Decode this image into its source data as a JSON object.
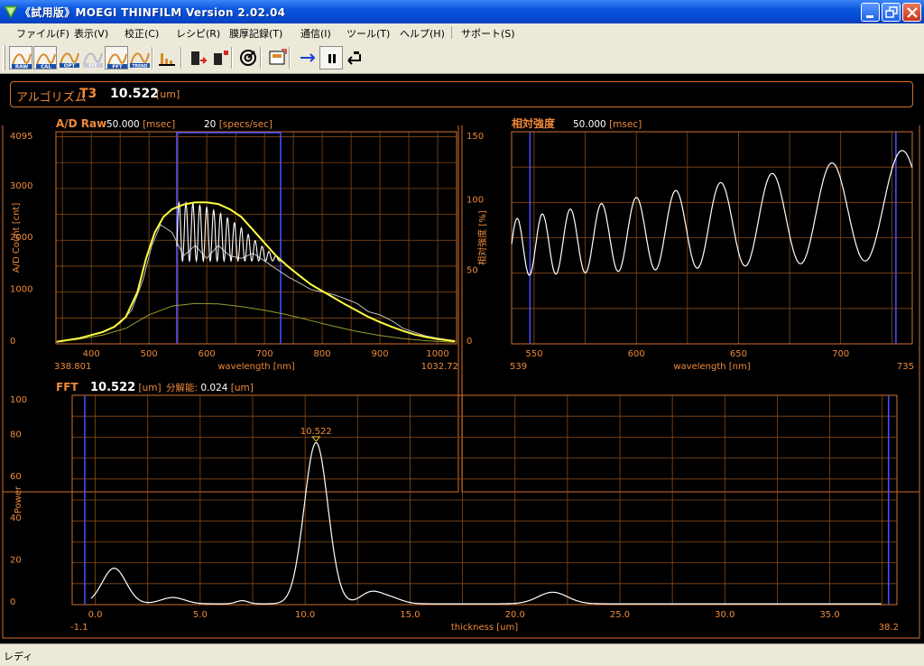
{
  "window": {
    "title": "《試用版》MOEGI THINFILM Version 2.02.04"
  },
  "menu": [
    "ファイル(F)",
    "表示(V)",
    "校正(C)",
    "レシピ(R)",
    "膜厚記録(T)",
    "通信(I)",
    "ツール(T)",
    "ヘルプ(H)",
    "サポート(S)"
  ],
  "toolbar": {
    "icons": [
      {
        "name": "raw-mode-icon",
        "label": "RAW",
        "pressed": true
      },
      {
        "name": "cal-mode-icon",
        "label": "CAL",
        "pressed": true
      },
      {
        "name": "opt-mode-icon",
        "label": "OPT",
        "pressed": false
      },
      {
        "name": "fit-mode-icon",
        "label": "FIT",
        "pressed": false
      },
      {
        "name": "fft-mode-icon",
        "label": "FFT",
        "pressed": true
      },
      {
        "name": "trend-mode-icon",
        "label": "TREND",
        "pressed": false
      }
    ]
  },
  "result": {
    "algorithm_label": "アルゴリズム",
    "algorithm": "T3",
    "value": "10.522",
    "unit": "[um]"
  },
  "status": {
    "text": "レディ"
  },
  "colors": {
    "accent": "#d2702c",
    "grid": "#8a4a16",
    "series_raw": "#ffff40",
    "series_gray": "#bdbdbd",
    "series_dark": "#9a9a30",
    "cursor": "#4e50ff",
    "trace": "#ffffff"
  },
  "chart_data": [
    {
      "name": "ad-raw-chart",
      "type": "line",
      "title": "A/D Raw",
      "header_items": [
        {
          "value": "50.000",
          "unit": "[msec]"
        },
        {
          "value": "20",
          "unit": "[specs/sec]"
        }
      ],
      "xlabel": "wavelength [nm]",
      "ylabel": "A/D Count [cnt]",
      "xlim": [
        338.801,
        1032.72
      ],
      "ylim": [
        0,
        4095
      ],
      "x_ticks": [
        400,
        500,
        600,
        700,
        800,
        900,
        1000
      ],
      "y_ticks": [
        0,
        1000,
        2000,
        3000,
        4095
      ],
      "x_min_label": "338.801",
      "x_max_label": "1032.72",
      "cursors": [
        548,
        728
      ],
      "grid": true,
      "series": [
        {
          "color": "series_dark",
          "x": [
            340,
            380,
            420,
            460,
            500,
            540,
            580,
            620,
            660,
            700,
            740,
            780,
            820,
            860,
            900,
            940,
            980,
            1030
          ],
          "y": [
            40,
            90,
            170,
            300,
            560,
            730,
            780,
            770,
            720,
            650,
            560,
            450,
            340,
            240,
            160,
            100,
            60,
            30
          ]
        },
        {
          "color": "series_gray",
          "x": [
            340,
            380,
            420,
            450,
            470,
            490,
            505,
            520,
            540,
            560,
            580,
            600,
            620,
            640,
            660,
            680,
            700,
            720,
            740,
            760,
            780,
            800,
            820,
            840,
            860,
            880,
            900,
            920,
            940,
            960,
            980,
            1000,
            1030
          ],
          "y": [
            40,
            110,
            220,
            400,
            650,
            1250,
            1900,
            2300,
            2150,
            1700,
            1900,
            1650,
            1900,
            1700,
            1650,
            1750,
            1600,
            1450,
            1300,
            1180,
            1050,
            1000,
            950,
            870,
            780,
            620,
            560,
            450,
            300,
            220,
            150,
            110,
            60
          ]
        },
        {
          "color": "series_raw",
          "x": [
            340,
            380,
            420,
            440,
            460,
            480,
            495,
            510,
            525,
            540,
            560,
            580,
            600,
            620,
            640,
            660,
            680,
            700,
            720,
            740,
            760,
            780,
            800,
            820,
            840,
            860,
            880,
            900,
            920,
            940,
            960,
            980,
            1000,
            1030
          ],
          "y": [
            40,
            110,
            230,
            330,
            520,
            1000,
            1650,
            2150,
            2450,
            2600,
            2690,
            2730,
            2730,
            2700,
            2600,
            2450,
            2200,
            1950,
            1700,
            1500,
            1320,
            1150,
            1020,
            890,
            760,
            640,
            520,
            420,
            330,
            250,
            180,
            130,
            90,
            50
          ]
        }
      ],
      "fringe": {
        "color": "trace",
        "x_start": 548,
        "x_end": 728,
        "period": 12,
        "lower": 1600
      }
    },
    {
      "name": "relative-intensity-chart",
      "type": "line",
      "title": "相対強度",
      "header_items": [
        {
          "value": "50.000",
          "unit": "[msec]"
        }
      ],
      "xlabel": "wavelength [nm]",
      "ylabel": "相対強度 [%]",
      "xlim": [
        539,
        735
      ],
      "ylim": [
        0,
        150
      ],
      "x_ticks": [
        550,
        600,
        650,
        700
      ],
      "y_ticks": [
        0,
        50,
        100,
        150
      ],
      "x_min_label": "539",
      "x_max_label": "735",
      "cursors": [
        548,
        727
      ],
      "grid": true,
      "wave": {
        "x_start": 539,
        "x_end": 735,
        "first_peak": 554,
        "base_period": 12.2,
        "period_growth": 0.0042,
        "min_start": 48,
        "min_end": 60,
        "max_start": 88,
        "max_end": 138
      }
    },
    {
      "name": "fft-chart",
      "type": "line",
      "title": "FFT",
      "header_items": [
        {
          "value": "10.522",
          "unit": "[um]"
        },
        {
          "label": "分解能:",
          "value": "0.024",
          "unit": "[um]"
        }
      ],
      "xlabel": "thickness [um]",
      "ylabel": "Power",
      "xlim": [
        -1.1,
        38.2
      ],
      "ylim": [
        0,
        100
      ],
      "x_ticks": [
        0.0,
        5.0,
        10.0,
        15.0,
        20.0,
        25.0,
        30.0,
        35.0
      ],
      "y_ticks": [
        0,
        20,
        40,
        60,
        80,
        100
      ],
      "x_min_label": "-1.1",
      "x_max_label": "38.2",
      "cursors": [
        -0.5,
        37.8
      ],
      "grid": true,
      "peak_label": {
        "x": 10.522,
        "y": 78,
        "text": "10.522"
      },
      "peaks": [
        {
          "center": 0.9,
          "width": 0.8,
          "height": 17
        },
        {
          "center": 3.7,
          "width": 0.8,
          "height": 3
        },
        {
          "center": 10.522,
          "width": 0.8,
          "height": 77
        },
        {
          "center": 13.1,
          "width": 0.7,
          "height": 5
        },
        {
          "center": 14.0,
          "width": 0.8,
          "height": 3
        },
        {
          "center": 21.8,
          "width": 1.0,
          "height": 5.5
        },
        {
          "center": 7.0,
          "width": 0.4,
          "height": 1.5
        }
      ]
    }
  ]
}
